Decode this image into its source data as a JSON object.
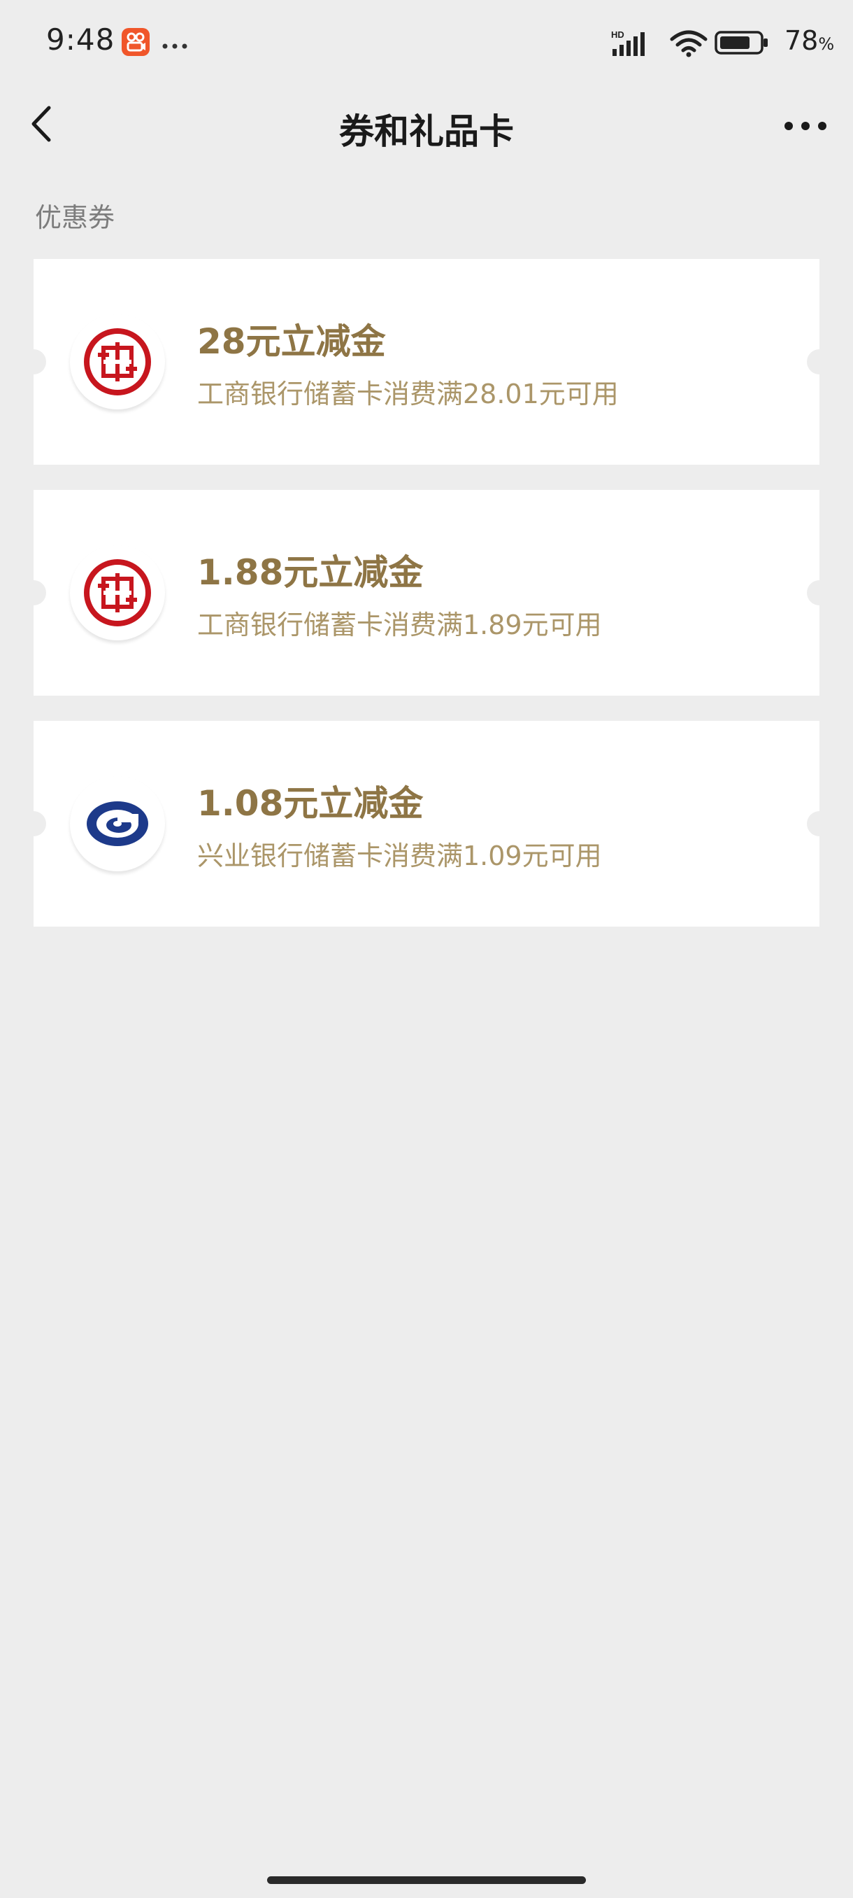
{
  "status_bar": {
    "time": "9:48",
    "network": "HD",
    "battery_level": "78",
    "battery_unit": "%",
    "battery_fill_fraction": 0.78,
    "app_icon": "kuaishou-app-icon",
    "more_icon": "ellipsis-icon"
  },
  "nav": {
    "title": "券和礼品卡",
    "back_icon": "chevron-left-icon",
    "more_icon": "more-dots-icon"
  },
  "section": {
    "title": "优惠券"
  },
  "coupons": [
    {
      "bank_icon": "icbc-logo-icon",
      "title": "28元立减金",
      "description": "工商银行储蓄卡消费满28.01元可用"
    },
    {
      "bank_icon": "icbc-logo-icon",
      "title": "1.88元立减金",
      "description": "工商银行储蓄卡消费满1.89元可用"
    },
    {
      "bank_icon": "cib-logo-icon",
      "title": "1.08元立减金",
      "description": "兴业银行储蓄卡消费满1.09元可用"
    }
  ],
  "colors": {
    "background": "#ededed",
    "coupon_title": "#8e7545",
    "coupon_desc": "#ab9669",
    "icbc_red": "#c7161e",
    "cib_blue": "#1d3a8a"
  }
}
